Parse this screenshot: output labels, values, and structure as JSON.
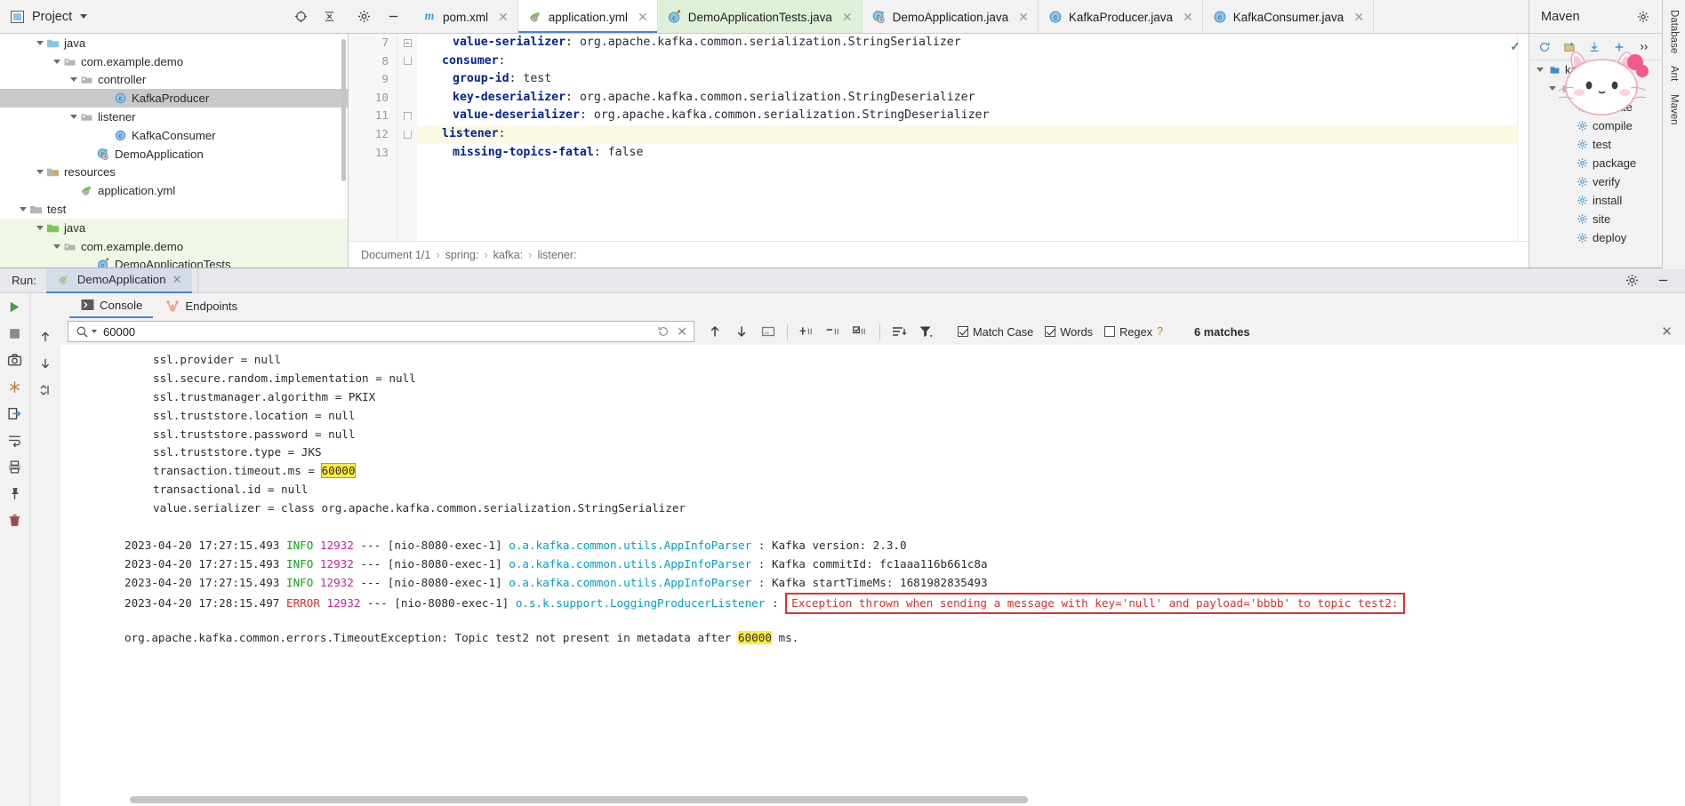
{
  "project_panel": {
    "title": "Project",
    "tree": [
      {
        "label": "java",
        "indent": 2,
        "icon": "folder-blue",
        "expanded": true,
        "state": "normal"
      },
      {
        "label": "com.example.demo",
        "indent": 3,
        "icon": "package",
        "expanded": true,
        "state": "normal"
      },
      {
        "label": "controller",
        "indent": 4,
        "icon": "package",
        "expanded": true,
        "state": "normal"
      },
      {
        "label": "KafkaProducer",
        "indent": 6,
        "icon": "class",
        "expanded": null,
        "state": "selected"
      },
      {
        "label": "listener",
        "indent": 4,
        "icon": "package",
        "expanded": true,
        "state": "normal"
      },
      {
        "label": "KafkaConsumer",
        "indent": 6,
        "icon": "class",
        "expanded": null,
        "state": "normal"
      },
      {
        "label": "DemoApplication",
        "indent": 5,
        "icon": "class-run",
        "expanded": null,
        "state": "normal"
      },
      {
        "label": "resources",
        "indent": 2,
        "icon": "folder-res",
        "expanded": true,
        "state": "normal"
      },
      {
        "label": "application.yml",
        "indent": 4,
        "icon": "yml",
        "expanded": null,
        "state": "normal"
      },
      {
        "label": "test",
        "indent": 1,
        "icon": "folder-grey",
        "expanded": true,
        "state": "normal"
      },
      {
        "label": "java",
        "indent": 2,
        "icon": "folder-green",
        "expanded": true,
        "state": "test"
      },
      {
        "label": "com.example.demo",
        "indent": 3,
        "icon": "package",
        "expanded": true,
        "state": "test"
      },
      {
        "label": "DemoApplicationTests",
        "indent": 5,
        "icon": "class-test",
        "expanded": null,
        "state": "test"
      }
    ]
  },
  "editor": {
    "tabs": [
      {
        "label": "pom.xml",
        "icon": "maven-m",
        "state": "normal"
      },
      {
        "label": "application.yml",
        "icon": "yml",
        "state": "active"
      },
      {
        "label": "DemoApplicationTests.java",
        "icon": "class-test",
        "state": "testfile"
      },
      {
        "label": "DemoApplication.java",
        "icon": "class-run",
        "state": "normal"
      },
      {
        "label": "KafkaProducer.java",
        "icon": "class",
        "state": "normal"
      },
      {
        "label": "KafkaConsumer.java",
        "icon": "class",
        "state": "normal"
      }
    ],
    "lines": [
      {
        "num": "7",
        "key": "value-serializer",
        "sep": ":",
        "value": " org.apache.kafka.common.serialization.StringSerializer",
        "indent": 26,
        "current": false,
        "fold": "mid"
      },
      {
        "num": "8",
        "key": "consumer",
        "sep": ":",
        "value": "",
        "indent": 14,
        "current": false,
        "fold": "top"
      },
      {
        "num": "9",
        "key": "group-id",
        "sep": ":",
        "value": " test",
        "indent": 26,
        "current": false,
        "fold": "none"
      },
      {
        "num": "10",
        "key": "key-deserializer",
        "sep": ":",
        "value": " org.apache.kafka.common.serialization.StringDeserializer",
        "indent": 26,
        "current": false,
        "fold": "none"
      },
      {
        "num": "11",
        "key": "value-deserializer",
        "sep": ":",
        "value": " org.apache.kafka.common.serialization.StringDeserializer",
        "indent": 26,
        "current": false,
        "fold": "bot"
      },
      {
        "num": "12",
        "key": "listener",
        "sep": ":",
        "value": "",
        "indent": 14,
        "current": true,
        "fold": "top"
      },
      {
        "num": "13",
        "key": "missing-topics-fatal",
        "sep": ":",
        "value": " false",
        "indent": 26,
        "current": false,
        "fold": "none"
      }
    ],
    "breadcrumb": [
      "Document 1/1",
      "spring:",
      "kafka:",
      "listener:"
    ],
    "inspection_ok": "✓"
  },
  "maven_panel": {
    "title": "Maven",
    "root": "kafk",
    "goals": [
      "validate",
      "compile",
      "test",
      "package",
      "verify",
      "install",
      "site",
      "deploy"
    ]
  },
  "right_rail": [
    "Database",
    "Ant",
    "Maven"
  ],
  "run_panel": {
    "label": "Run:",
    "config_name": "DemoApplication",
    "tabs": [
      {
        "label": "Console",
        "icon": "console-icon",
        "active": true
      },
      {
        "label": "Endpoints",
        "icon": "endpoint-icon",
        "active": false
      }
    ],
    "find": {
      "value": "60000",
      "placeholder": "",
      "match_case_label": "Match Case",
      "words_label": "Words",
      "regex_label": "Regex",
      "help_label": "?",
      "match_case_checked": true,
      "words_checked": true,
      "regex_checked": false,
      "result_count": "6 matches"
    },
    "console_lines": [
      {
        "type": "plain",
        "indent": true,
        "text": "ssl.provider = null"
      },
      {
        "type": "plain",
        "indent": true,
        "text": "ssl.secure.random.implementation = null"
      },
      {
        "type": "plain",
        "indent": true,
        "text": "ssl.trustmanager.algorithm = PKIX"
      },
      {
        "type": "plain",
        "indent": true,
        "text": "ssl.truststore.location = null"
      },
      {
        "type": "plain",
        "indent": true,
        "text": "ssl.truststore.password = null"
      },
      {
        "type": "plain",
        "indent": true,
        "text": "ssl.truststore.type = JKS"
      },
      {
        "type": "hl",
        "indent": true,
        "pre": "transaction.timeout.ms = ",
        "hl": "60000",
        "post": "",
        "cursor": true
      },
      {
        "type": "plain",
        "indent": true,
        "text": "transactional.id = null"
      },
      {
        "type": "plain",
        "indent": true,
        "text": "value.serializer = class org.apache.kafka.common.serialization.StringSerializer"
      },
      {
        "type": "blank",
        "indent": false,
        "text": ""
      },
      {
        "type": "log",
        "ts": "2023-04-20 17:27:15.493",
        "level": "INFO",
        "pid": "12932",
        "dashes": "---",
        "thread": "[nio-8080-exec-1]",
        "logger": "o.a.kafka.common.utils.AppInfoParser",
        "msg": ": Kafka version: 2.3.0",
        "boxed": false
      },
      {
        "type": "log",
        "ts": "2023-04-20 17:27:15.493",
        "level": "INFO",
        "pid": "12932",
        "dashes": "---",
        "thread": "[nio-8080-exec-1]",
        "logger": "o.a.kafka.common.utils.AppInfoParser",
        "msg": ": Kafka commitId: fc1aaa116b661c8a",
        "boxed": false
      },
      {
        "type": "log",
        "ts": "2023-04-20 17:27:15.493",
        "level": "INFO",
        "pid": "12932",
        "dashes": "---",
        "thread": "[nio-8080-exec-1]",
        "logger": "o.a.kafka.common.utils.AppInfoParser",
        "msg": ": Kafka startTimeMs: 1681982835493",
        "boxed": false
      },
      {
        "type": "log",
        "ts": "2023-04-20 17:28:15.497",
        "level": "ERROR",
        "pid": "12932",
        "dashes": "---",
        "thread": "[nio-8080-exec-1]",
        "logger": "o.s.k.support.LoggingProducerListener",
        "msg": ":",
        "boxed": true,
        "boxed_text": "Exception thrown when sending a message with key='null' and payload='bbbb' to topic test2:"
      },
      {
        "type": "blank",
        "indent": false,
        "text": ""
      },
      {
        "type": "hl2",
        "indent": false,
        "pre": "org.apache.kafka.common.errors.TimeoutException: Topic test2 not present in metadata after ",
        "hl": "60000",
        "post": " ms."
      }
    ]
  },
  "colors": {
    "accent": "#4a86c8",
    "error_red": "#e03030",
    "highlight_yellow": "#ffeb3b",
    "info_green": "#18a018",
    "test_green": "#dff0d8",
    "selection_grey": "#c9c9c9"
  }
}
